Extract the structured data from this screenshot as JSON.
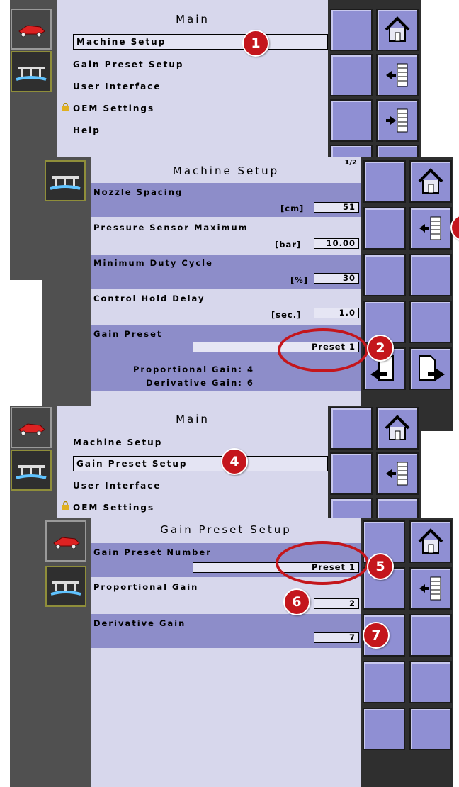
{
  "main1": {
    "title": "Main",
    "items": [
      "Machine Setup",
      "Gain Preset Setup",
      "User Interface",
      "OEM Settings",
      "Help"
    ]
  },
  "machine_setup": {
    "title": "Machine Setup",
    "page": "1/2",
    "nozzle_label": "Nozzle Spacing",
    "nozzle_unit": "[cm]",
    "nozzle_value": "51",
    "pressure_label": "Pressure Sensor Maximum",
    "pressure_unit": "[bar]",
    "pressure_value": "10.00",
    "duty_label": "Minimum Duty Cycle",
    "duty_unit": "[%]",
    "duty_value": "30",
    "hold_label": "Control Hold Delay",
    "hold_unit": "[sec.]",
    "hold_value": "1.0",
    "gain_label": "Gain Preset",
    "gain_value": "Preset 1",
    "prop_text": "Proportional Gain:  4",
    "deriv_text": "Derivative Gain:  6"
  },
  "main2": {
    "title": "Main",
    "items": [
      "Machine Setup",
      "Gain Preset Setup",
      "User Interface",
      "OEM Settings"
    ]
  },
  "gain_preset_setup": {
    "title": "Gain Preset Setup",
    "number_label": "Gain Preset Number",
    "number_value": "Preset 1",
    "prop_label": "Proportional Gain",
    "prop_value": "2",
    "deriv_label": "Derivative Gain",
    "deriv_value": "7"
  },
  "callouts": [
    "1",
    "2",
    "4",
    "5",
    "6",
    "7"
  ],
  "colors": {
    "accent": "#c4161c",
    "tile": "#8f8fd3",
    "band": "#8d8dc9",
    "panel": "#d7d7ec"
  }
}
